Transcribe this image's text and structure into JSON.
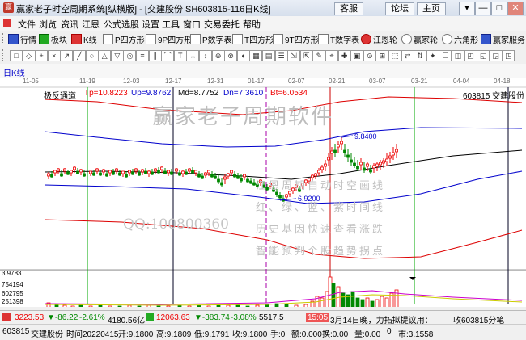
{
  "window": {
    "title": "赢家老子时空周期系统[纵横版] - [交建股份 SH603815-116日K线]",
    "buttons": [
      "客服",
      "论坛",
      "主页"
    ],
    "controls": [
      "▾",
      "—",
      "□",
      "✕"
    ]
  },
  "menu": [
    "文件",
    "浏览",
    "资讯",
    "江恩",
    "公式选股",
    "设置",
    "工具",
    "窗口",
    "交易委托",
    "帮助"
  ],
  "toolbar1": [
    "行情",
    "板块",
    "K线",
    "P四方形",
    "9P四方形",
    "P数字表",
    "T四方形",
    "9T四方形",
    "T数字表",
    "江恩轮",
    "赢家轮",
    "六角形",
    "赢家服务"
  ],
  "toolbar2_icons": [
    "1",
    "2",
    "3",
    "4",
    "5",
    "6",
    "7",
    "8",
    "9",
    "10",
    "11",
    "12",
    "13",
    "14",
    "15",
    "16",
    "17",
    "18",
    "19",
    "20",
    "21",
    "22",
    "23",
    "24",
    "25",
    "26",
    "27",
    "28",
    "29",
    "30",
    "31",
    "32",
    "33",
    "34",
    "35",
    "36",
    "37",
    "38",
    "39",
    "40"
  ],
  "chart_header": {
    "date_ticks": [
      "11-05",
      "11-19",
      "12-03",
      "12-17",
      "12-31",
      "01-17",
      "02-07",
      "02-21",
      "03-07",
      "03-21",
      "04-04",
      "04-18"
    ],
    "period": "日K线",
    "indicator_name": "极反通道",
    "tp": "Tp=10.8223",
    "up": "Up=9.8762",
    "md": "Md=8.7752",
    "dn": "Dn=7.3610",
    "bt": "Bt=6.0534",
    "stock": "603815 交建股份"
  },
  "annotations": {
    "high_label": "9.8400",
    "low_label": "6.9200",
    "watermark_title": "赢家老子周期软件",
    "watermark_qq": "QQ:100800360",
    "watermark_lines": [
      "江恩周期自动时空画线",
      "红、绿、蓝、紫时间线",
      "历史基因快速查看涨跌",
      "智能预判个股趋势拐点"
    ]
  },
  "volume_axis": [
    "3.9783",
    "754194",
    "602795",
    "251398"
  ],
  "status": {
    "sh_index": "3223.53",
    "sh_change": "▼-86.22",
    "sh_pct": "-2.61%",
    "sh_amount": "4180.56亿",
    "sz_index": "12063.63",
    "sz_change": "▼-383.74",
    "sz_pct": "-3.08%",
    "sz_amount": "5517.5",
    "time": "15:05",
    "news": "3月14日晚，力拓拟提议用：",
    "alert": "收603815分笔"
  },
  "info": {
    "code": "603815",
    "name": "交建股份",
    "time_label": "时间20220415",
    "open": "开:9.1800",
    "high": "高:9.1809",
    "low": "低:9.1791",
    "close": "收:9.1800",
    "hand": "手:0",
    "amount": "额:0.000",
    "turnover": "换:0.00",
    "volume": "量:0.00",
    "lots": "0",
    "market_cap": "市:3.1558"
  },
  "chart_data": {
    "type": "line",
    "x_range": [
      "11-05",
      "04-18"
    ],
    "series": [],
    "price_levels": {
      "Tp": 10.8223,
      "Up": 9.8762,
      "Md": 8.7752,
      "Dn": 7.361,
      "Bt": 6.0534
    },
    "marked_high": 9.84,
    "marked_low": 6.92,
    "volume_ticks": [
      754194,
      602795,
      251398
    ]
  }
}
